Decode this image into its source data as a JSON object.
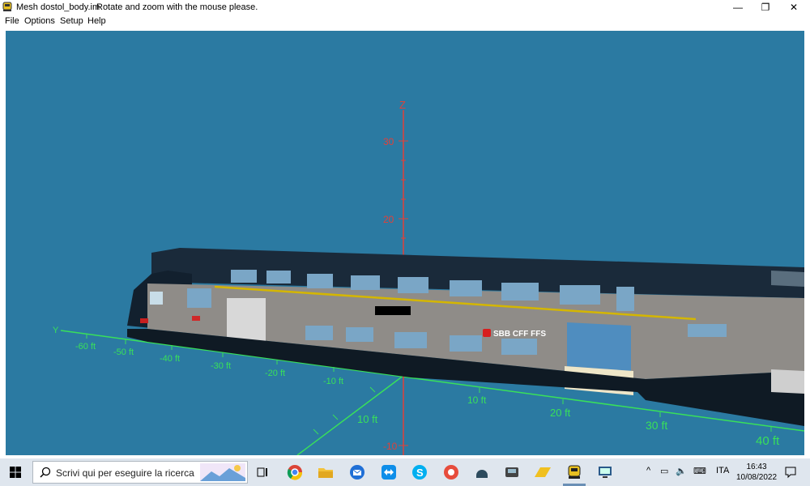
{
  "window": {
    "title": "Mesh dostol_body.im",
    "hint": "Rotate and zoom with the mouse please.",
    "controls": {
      "minimize": "—",
      "restore": "❐",
      "close": "✕"
    }
  },
  "menu": [
    "File",
    "Options",
    "Setup",
    "Help"
  ],
  "viewport": {
    "background": "#2b7aa2",
    "axis_color": "#e0413a",
    "tick_color_z": "#e0413a",
    "grid_color": "#39e05a",
    "z_axis": {
      "label": "Z",
      "ticks": [
        "30",
        "20",
        "-10"
      ]
    },
    "y_axis": {
      "label": "Y",
      "ticks": [
        "-60 ft",
        "-50 ft",
        "-40 ft",
        "-30 ft",
        "-20 ft",
        "-10 ft",
        "10 ft",
        "20 ft",
        "30 ft",
        "40 ft"
      ]
    },
    "x_axis": {
      "ticks": [
        "10 ft"
      ]
    },
    "train_logo_text": "SBB CFF FFS"
  },
  "taskbar": {
    "search_placeholder": "Scrivi qui per eseguire la ricerca",
    "language": "ITA",
    "time": "16:43",
    "date": "10/08/2022",
    "pinned_icons": [
      "task-view-icon",
      "chrome-icon",
      "file-explorer-icon",
      "thunderbird-icon",
      "teamviewer-icon",
      "skype-icon",
      "ccleaner-icon",
      "app-icon-helmet",
      "app-icon-locomotive",
      "onedrive-folder-icon",
      "train-simulator-icon",
      "remote-desktop-icon"
    ]
  }
}
